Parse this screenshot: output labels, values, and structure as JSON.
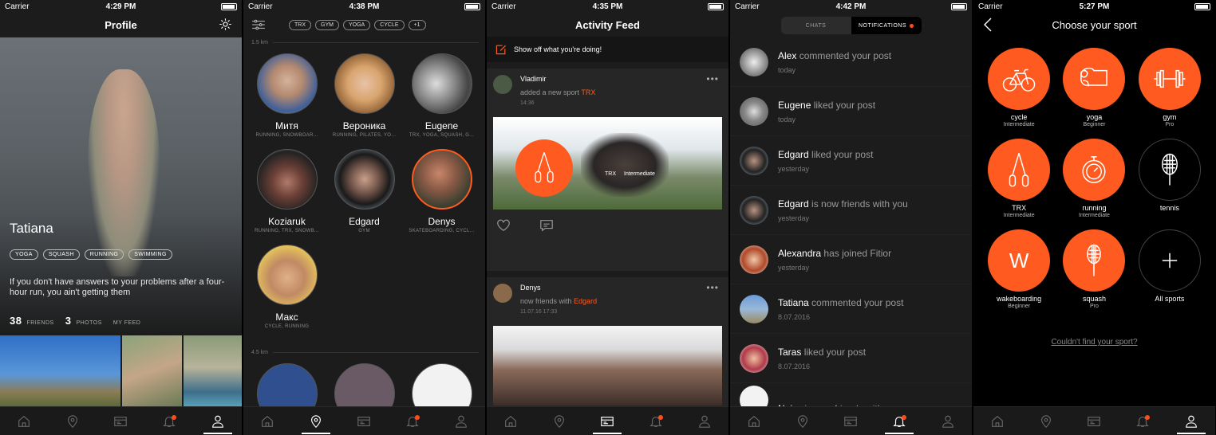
{
  "status": {
    "carrier": "Carrier"
  },
  "profile": {
    "time": "4:29 PM",
    "title": "Profile",
    "name": "Tatiana",
    "tags": [
      "YOGA",
      "SQUASH",
      "RUNNING",
      "SWIMMING"
    ],
    "bio": "If you don't have answers to your problems after a four-hour run, you ain't getting them",
    "friends_count": "38",
    "friends_label": "FRIENDS",
    "photos_count": "3",
    "photos_label": "PHOTOS",
    "feed_label": "MY FEED"
  },
  "discover": {
    "time": "4:38 PM",
    "chips": [
      "TRX",
      "GYM",
      "YOGA",
      "CYCLE",
      "+1"
    ],
    "distance1": "1.5 km",
    "distance2": "4.5 km",
    "people": [
      {
        "name": "Митя",
        "sports": "RUNNING, SNOWBOAR..."
      },
      {
        "name": "Вероника",
        "sports": "RUNNING, PILATES, YO..."
      },
      {
        "name": "Eugene",
        "sports": "TRX, YOGA, SQUASH, G..."
      },
      {
        "name": "Koziaruk",
        "sports": "RUNNING, TRX, SNOWB..."
      },
      {
        "name": "Edgard",
        "sports": "GYM"
      },
      {
        "name": "Denys",
        "sports": "SKATEBOARDING, CYCL..."
      },
      {
        "name": "Макс",
        "sports": "CYCLE, RUNNING"
      }
    ]
  },
  "feed": {
    "time": "4:35 PM",
    "title": "Activity Feed",
    "show_off": "Show off what you're doing!",
    "post1": {
      "name": "Vladimir",
      "action": "added a new sport",
      "sport": "TRX",
      "ts": "14:36",
      "overlay_sport": "TRX",
      "overlay_level": "Intermediate"
    },
    "post2": {
      "name": "Denys",
      "action": "now friends with",
      "friend": "Edgard",
      "ts": "11.07.16 17:33"
    }
  },
  "notifications": {
    "time": "4:42 PM",
    "tab_chats": "CHATS",
    "tab_notifications": "NOTIFICATIONS",
    "items": [
      {
        "who": "Alex",
        "what": "commented your post",
        "when": "today"
      },
      {
        "who": "Eugene",
        "what": "liked your post",
        "when": "today"
      },
      {
        "who": "Edgard",
        "what": "liked your post",
        "when": "yesterday"
      },
      {
        "who": "Edgard",
        "what": "is now friends with you",
        "when": "yesterday"
      },
      {
        "who": "Alexandra",
        "what": "has joined Fitior",
        "when": "yesterday"
      },
      {
        "who": "Tatiana",
        "what": "commented your post",
        "when": "8.07.2016"
      },
      {
        "who": "Taras",
        "what": "liked your post",
        "when": "8.07.2016"
      },
      {
        "who": "Noisy",
        "what": "is now friends with you",
        "when": ""
      }
    ]
  },
  "sports": {
    "time": "5:27 PM",
    "title": "Choose your sport",
    "items": [
      {
        "name": "cycle",
        "level": "Intermediate"
      },
      {
        "name": "yoga",
        "level": "Beginner"
      },
      {
        "name": "gym",
        "level": "Pro"
      },
      {
        "name": "TRX",
        "level": "Intermediate"
      },
      {
        "name": "running",
        "level": "Intermediate"
      },
      {
        "name": "tennis",
        "level": ""
      },
      {
        "name": "wakeboarding",
        "level": "Beginner"
      },
      {
        "name": "squash",
        "level": "Pro"
      },
      {
        "name": "All sports",
        "level": ""
      }
    ],
    "wakeboard_letter": "W",
    "cant_find": "Couldn't find your sport?"
  },
  "colors": {
    "accent": "#ff5a1f",
    "notification_dot": "#ff4d1a"
  }
}
